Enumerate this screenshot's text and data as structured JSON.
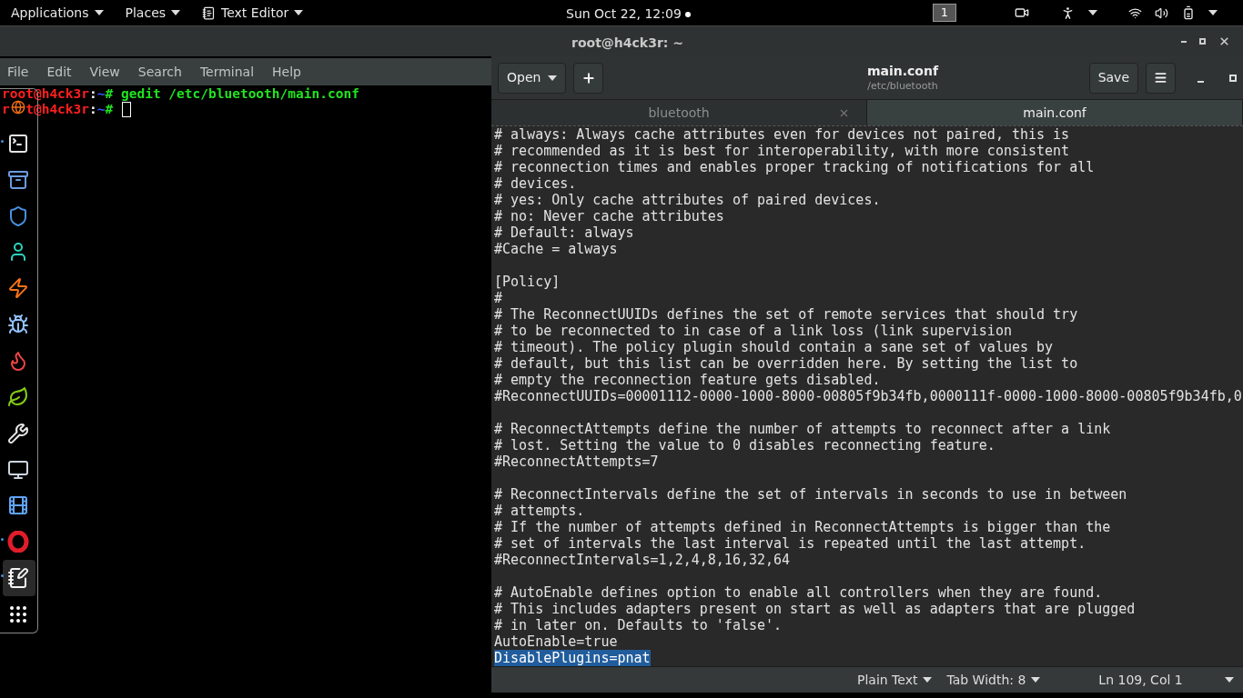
{
  "top_bar": {
    "menus": [
      {
        "label": "Applications"
      },
      {
        "label": "Places"
      },
      {
        "label": "Text Editor",
        "icon": true
      }
    ],
    "clock": "Sun Oct 22, 12:09",
    "workspace": "1"
  },
  "terminal": {
    "title": "root@h4ck3r: ~",
    "menu": [
      "File",
      "Edit",
      "View",
      "Search",
      "Terminal",
      "Help"
    ],
    "lines": [
      {
        "user_host": "root@h4ck3r",
        "separator": ":",
        "path": "~",
        "symbol": "#",
        "command": "gedit /etc/bluetooth/main.conf",
        "cursor": false
      },
      {
        "user_host": "r",
        "user_host_tail": "t@h4ck3r",
        "separator": ":",
        "path": "~",
        "symbol": "#",
        "cursor": true
      }
    ]
  },
  "dock": {
    "items": [
      {
        "kind": "browser",
        "running": false
      },
      {
        "kind": "terminal",
        "running": true
      },
      {
        "kind": "files",
        "running": false
      },
      {
        "kind": "shield",
        "running": false
      },
      {
        "kind": "person",
        "running": false
      },
      {
        "kind": "bolt",
        "running": false
      },
      {
        "kind": "bug",
        "running": false
      },
      {
        "kind": "flame",
        "running": false
      },
      {
        "kind": "leaf",
        "running": false
      },
      {
        "kind": "tools",
        "running": false
      },
      {
        "kind": "monitor",
        "running": false
      },
      {
        "kind": "film",
        "running": false
      },
      {
        "kind": "ring",
        "running": true
      },
      {
        "kind": "editor",
        "running": true,
        "selected": true
      },
      {
        "kind": "grid",
        "running": false
      }
    ]
  },
  "editor": {
    "open_button": "Open",
    "title": "main.conf",
    "subtitle": "/etc/bluetooth",
    "save_button": "Save",
    "tabs": [
      {
        "label": "bluetooth",
        "selected": false
      },
      {
        "label": "main.conf",
        "selected": true
      }
    ],
    "lines": [
      {
        "kind": "text",
        "text": "# always: Always cache attributes even for devices not paired, this is",
        "selected": false
      },
      {
        "kind": "text",
        "text": "# recommended as it is best for interoperability, with more consistent",
        "selected": false
      },
      {
        "kind": "text",
        "text": "# reconnection times and enables proper tracking of notifications for all",
        "selected": false
      },
      {
        "kind": "text",
        "text": "# devices.",
        "selected": false
      },
      {
        "kind": "text",
        "text": "# yes: Only cache attributes of paired devices.",
        "selected": false
      },
      {
        "kind": "text",
        "text": "# no: Never cache attributes",
        "selected": false
      },
      {
        "kind": "text",
        "text": "# Default: always",
        "selected": false
      },
      {
        "kind": "text",
        "text": "#Cache = always",
        "selected": false
      },
      {
        "kind": "blank"
      },
      {
        "kind": "text",
        "text": "[Policy]",
        "selected": false
      },
      {
        "kind": "text",
        "text": "#",
        "selected": false
      },
      {
        "kind": "text",
        "text": "# The ReconnectUUIDs defines the set of remote services that should try",
        "selected": false
      },
      {
        "kind": "text",
        "text": "# to be reconnected to in case of a link loss (link supervision",
        "selected": false
      },
      {
        "kind": "text",
        "text": "# timeout). The policy plugin should contain a sane set of values by",
        "selected": false
      },
      {
        "kind": "text",
        "text": "# default, but this list can be overridden here. By setting the list to",
        "selected": false
      },
      {
        "kind": "text",
        "text": "# empty the reconnection feature gets disabled.",
        "selected": false
      },
      {
        "kind": "text",
        "text": "#ReconnectUUIDs=00001112-0000-1000-8000-00805f9b34fb,0000111f-0000-1000-8000-00805f9b34fb,0",
        "selected": false
      },
      {
        "kind": "blank"
      },
      {
        "kind": "text",
        "text": "# ReconnectAttempts define the number of attempts to reconnect after a link",
        "selected": false
      },
      {
        "kind": "text",
        "text": "# lost. Setting the value to 0 disables reconnecting feature.",
        "selected": false
      },
      {
        "kind": "text",
        "text": "#ReconnectAttempts=7",
        "selected": false
      },
      {
        "kind": "blank"
      },
      {
        "kind": "text",
        "text": "# ReconnectIntervals define the set of intervals in seconds to use in between",
        "selected": false
      },
      {
        "kind": "text",
        "text": "# attempts.",
        "selected": false
      },
      {
        "kind": "text",
        "text": "# If the number of attempts defined in ReconnectAttempts is bigger than the",
        "selected": false
      },
      {
        "kind": "text",
        "text": "# set of intervals the last interval is repeated until the last attempt.",
        "selected": false
      },
      {
        "kind": "text",
        "text": "#ReconnectIntervals=1,2,4,8,16,32,64",
        "selected": false
      },
      {
        "kind": "blank"
      },
      {
        "kind": "text",
        "text": "# AutoEnable defines option to enable all controllers when they are found.",
        "selected": false
      },
      {
        "kind": "text",
        "text": "# This includes adapters present on start as well as adapters that are plugged",
        "selected": false
      },
      {
        "kind": "text",
        "text": "# in later on. Defaults to 'false'.",
        "selected": false
      },
      {
        "kind": "text",
        "text": "AutoEnable=true",
        "selected": false
      },
      {
        "kind": "text",
        "text": "DisablePlugins=pnat",
        "selected": true
      }
    ],
    "status_bar": {
      "language": "Plain Text",
      "tab_width": "Tab Width: 8",
      "position": "Ln 109, Col 1"
    }
  }
}
